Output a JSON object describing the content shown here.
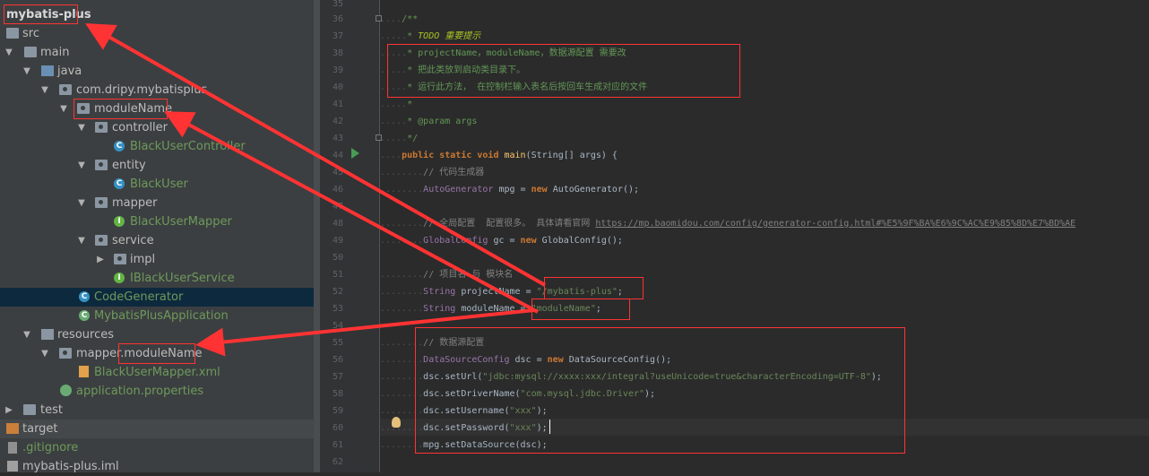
{
  "project_tree": {
    "items": [
      {
        "label": "mybatis-plus",
        "icon": "project-folder-icon"
      },
      {
        "label": "src",
        "icon": "folder-icon"
      },
      {
        "label": "main",
        "icon": "folder-icon"
      },
      {
        "label": "java",
        "icon": "source-folder-icon"
      },
      {
        "label": "com.dripy.mybatisplus",
        "icon": "package-icon"
      },
      {
        "label": "moduleName",
        "icon": "package-icon"
      },
      {
        "label": "controller",
        "icon": "package-icon"
      },
      {
        "label": "BlackUserController",
        "icon": "class-icon"
      },
      {
        "label": "entity",
        "icon": "package-icon"
      },
      {
        "label": "BlackUser",
        "icon": "class-icon"
      },
      {
        "label": "mapper",
        "icon": "package-icon"
      },
      {
        "label": "BlackUserMapper",
        "icon": "interface-icon"
      },
      {
        "label": "service",
        "icon": "package-icon"
      },
      {
        "label": "impl",
        "icon": "package-icon"
      },
      {
        "label": "IBlackUserService",
        "icon": "interface-icon"
      },
      {
        "label": "CodeGenerator",
        "icon": "class-icon"
      },
      {
        "label": "MybatisPlusApplication",
        "icon": "spring-boot-icon"
      },
      {
        "label": "resources",
        "icon": "resources-folder-icon"
      },
      {
        "label": "mapper.moduleName",
        "icon": "package-icon"
      },
      {
        "label": "BlackUserMapper.xml",
        "icon": "xml-file-icon"
      },
      {
        "label": "application.properties",
        "icon": "properties-file-icon"
      },
      {
        "label": "test",
        "icon": "folder-icon"
      },
      {
        "label": "target",
        "icon": "folder-icon"
      },
      {
        "label": ".gitignore",
        "icon": "gitignore-file-icon"
      },
      {
        "label": "mybatis-plus.iml",
        "icon": "iml-file-icon"
      }
    ]
  },
  "editor": {
    "line_numbers": [
      "35",
      "36",
      "37",
      "38",
      "39",
      "40",
      "41",
      "42",
      "43",
      "44",
      "45",
      "46",
      "47",
      "48",
      "49",
      "50",
      "51",
      "52",
      "53",
      "54",
      "55",
      "56",
      "57",
      "58",
      "59",
      "60",
      "61",
      "62"
    ],
    "code": {
      "l36": "/**",
      "l37_prefix": "* ",
      "l37_todo": "TODO 重要提示",
      "l38": "* projectName，moduleName，数据源配置 需要改",
      "l39": "* 把此类放到启动类目录下。",
      "l40": "* 运行此方法， 在控制栏输入表名后按回车生成对应的文件",
      "l41": "*",
      "l42": "* @param args",
      "l43": "*/",
      "l44_kw": "public static void ",
      "l44_fn": "main",
      "l44_rest": "(String[] args) {",
      "l45": "// 代码生成器",
      "l46_ty": "AutoGenerator",
      "l46_mid": " mpg = ",
      "l46_new": "new",
      "l46_rest": " AutoGenerator();",
      "l48_cm": "// 全局配置  配置很多。 具体请看官网 ",
      "l48_url": "https://mp.baomidou.com/config/generator-config.html#%E5%9F%BA%E6%9C%AC%E9%85%8D%E7%BD%AE",
      "l49_ty": "GlobalConfig",
      "l49_mid": " gc = ",
      "l49_new": "new",
      "l49_rest": " GlobalConfig();",
      "l51": "// 项目名 与 模块名",
      "l52_ty": "String",
      "l52_mid": " projectName = ",
      "l52_str": "\"/mybatis-plus\"",
      "l52_end": ";",
      "l53_ty": "String",
      "l53_mid": " moduleName = ",
      "l53_str": "\"moduleName\"",
      "l53_end": ";",
      "l55": "// 数据源配置",
      "l56_ty": "DataSourceConfig",
      "l56_mid": " dsc = ",
      "l56_new": "new",
      "l56_rest": " DataSourceConfig();",
      "l57_pre": "dsc.setUrl(",
      "l57_str": "\"jdbc:mysql://xxxx:xxx/integral?useUnicode=true&characterEncoding=UTF-8\"",
      "l57_end": ");",
      "l58_pre": "dsc.setDriverName(",
      "l58_str": "\"com.mysql.jdbc.Driver\"",
      "l58_end": ");",
      "l59_pre": "dsc.setUsername(",
      "l59_str": "\"xxx\"",
      "l59_end": ");",
      "l60_pre": "dsc.setPassword(",
      "l60_str": "\"xxx\"",
      "l60_end": ");",
      "l61": "mpg.setDataSource(dsc);"
    }
  },
  "colors": {
    "annotation_red": "#ff3333",
    "tree_bg": "#3c3f41",
    "editor_bg": "#2b2b2b",
    "keyword": "#cc7832",
    "string": "#6a8759",
    "comment": "#808080"
  }
}
